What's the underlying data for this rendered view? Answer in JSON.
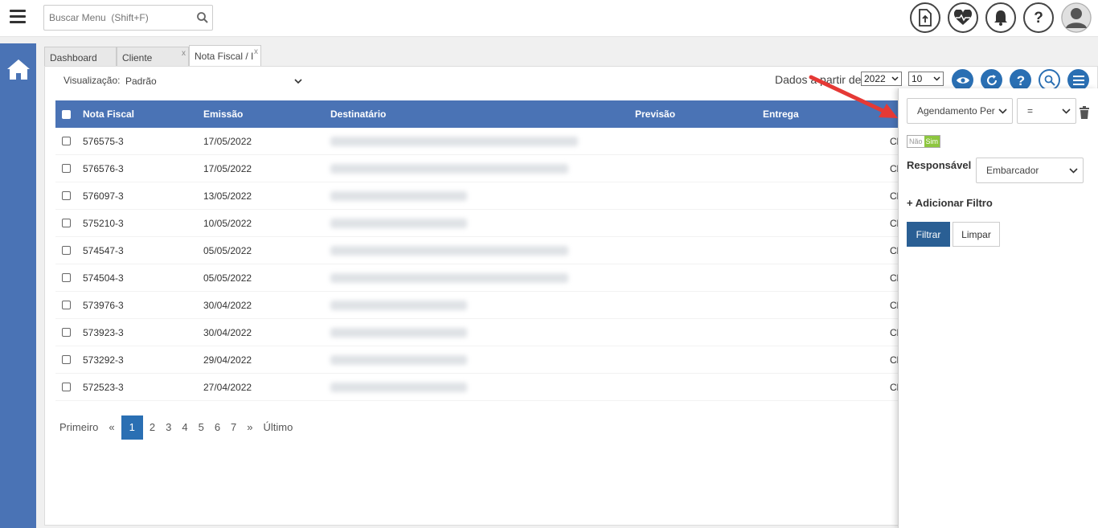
{
  "search": {
    "placeholder": "Buscar Menu  (Shift+F)"
  },
  "top_icons": [
    "upload-icon",
    "heart-pulse-icon",
    "bell-icon",
    "help-icon",
    "user-avatar-icon"
  ],
  "tabs": [
    {
      "label": "Dashboard",
      "closable": false
    },
    {
      "label": "Cliente",
      "close": "x"
    },
    {
      "label": "Nota Fiscal / I",
      "close": "x"
    }
  ],
  "toolbar": {
    "vis_label": "Visualização:",
    "vis_value": "Padrão",
    "dados_label": "Dados a partir de:",
    "year": "2022",
    "page_size": "10"
  },
  "table": {
    "headers": [
      "Nota Fiscal",
      "Emissão",
      "Destinatário",
      "Previsão",
      "Entrega"
    ],
    "rows": [
      {
        "nf": "576575-3",
        "emissao": "17/05/2022",
        "status": "Cl"
      },
      {
        "nf": "576576-3",
        "emissao": "17/05/2022",
        "status": "Cl"
      },
      {
        "nf": "576097-3",
        "emissao": "13/05/2022",
        "status": "Cl"
      },
      {
        "nf": "575210-3",
        "emissao": "10/05/2022",
        "status": "Cl"
      },
      {
        "nf": "574547-3",
        "emissao": "05/05/2022",
        "status": "Cl"
      },
      {
        "nf": "574504-3",
        "emissao": "05/05/2022",
        "status": "Cl"
      },
      {
        "nf": "573976-3",
        "emissao": "30/04/2022",
        "status": "Cl"
      },
      {
        "nf": "573923-3",
        "emissao": "30/04/2022",
        "status": "Cl"
      },
      {
        "nf": "573292-3",
        "emissao": "29/04/2022",
        "status": "Cl"
      },
      {
        "nf": "572523-3",
        "emissao": "27/04/2022",
        "status": "Cl"
      }
    ]
  },
  "pagination": {
    "first": "Primeiro",
    "prev": "«",
    "pages": [
      "1",
      "2",
      "3",
      "4",
      "5",
      "6",
      "7"
    ],
    "next": "»",
    "last": "Último",
    "current": "1"
  },
  "filter": {
    "field": "Agendamento Per",
    "operator": "=",
    "toggle_off": "Não",
    "toggle_on": "Sim",
    "responsavel_label": "Responsável",
    "responsavel_value": "Embarcador",
    "add_filter": "+ Adicionar Filtro",
    "apply": "Filtrar",
    "clear": "Limpar"
  },
  "colors": {
    "nav": "#4a73b5",
    "header": "#4a73b5",
    "accent": "#2a6fb3",
    "toggle_on": "#8dc63f",
    "arrow": "#e53935"
  }
}
